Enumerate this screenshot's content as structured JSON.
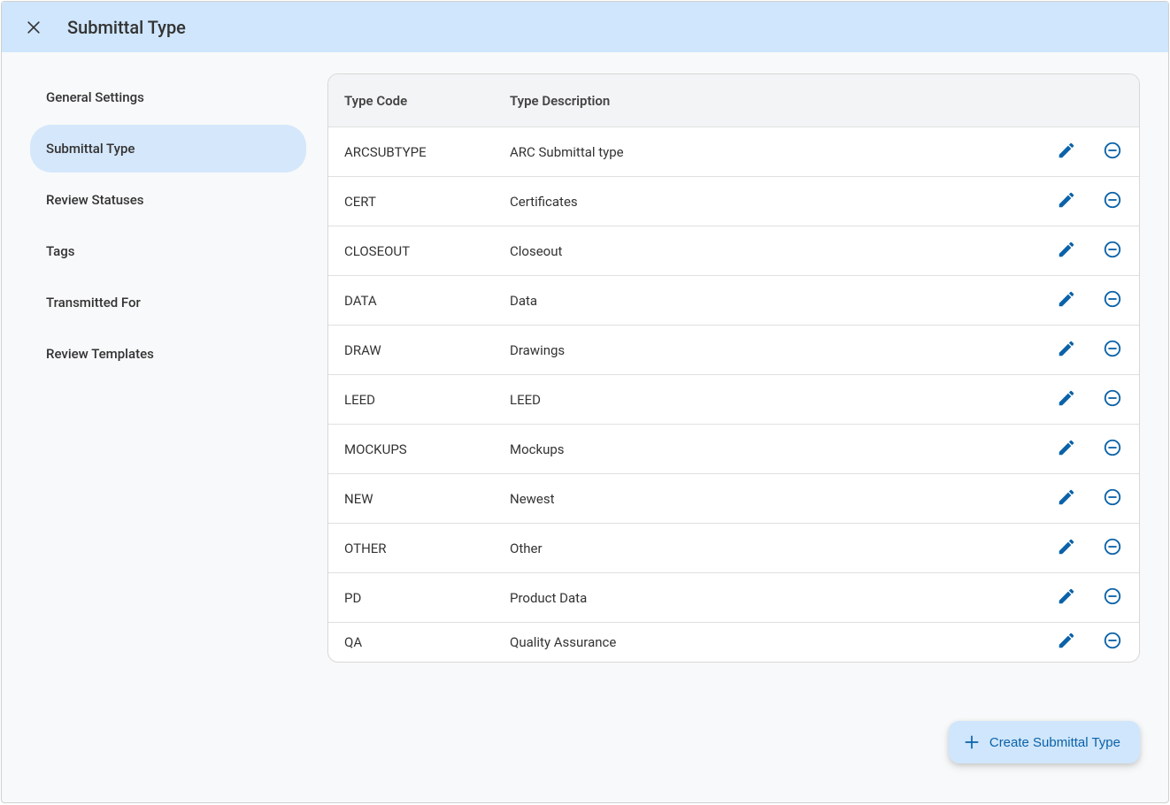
{
  "header": {
    "title": "Submittal Type"
  },
  "sidebar": {
    "items": [
      {
        "label": "General Settings",
        "active": false
      },
      {
        "label": "Submittal Type",
        "active": true
      },
      {
        "label": "Review Statuses",
        "active": false
      },
      {
        "label": "Tags",
        "active": false
      },
      {
        "label": "Transmitted For",
        "active": false
      },
      {
        "label": "Review Templates",
        "active": false
      }
    ]
  },
  "table": {
    "headers": {
      "code": "Type Code",
      "description": "Type Description"
    },
    "rows": [
      {
        "code": "ARCSUBTYPE",
        "description": "ARC Submittal type"
      },
      {
        "code": "CERT",
        "description": "Certificates"
      },
      {
        "code": "CLOSEOUT",
        "description": "Closeout"
      },
      {
        "code": "DATA",
        "description": "Data"
      },
      {
        "code": "DRAW",
        "description": "Drawings"
      },
      {
        "code": "LEED",
        "description": "LEED"
      },
      {
        "code": "MOCKUPS",
        "description": "Mockups"
      },
      {
        "code": "NEW",
        "description": "Newest"
      },
      {
        "code": "OTHER",
        "description": "Other"
      },
      {
        "code": "PD",
        "description": "Product Data"
      },
      {
        "code": "QA",
        "description": "Quality Assurance"
      }
    ]
  },
  "actions": {
    "create_label": "Create Submittal Type"
  }
}
